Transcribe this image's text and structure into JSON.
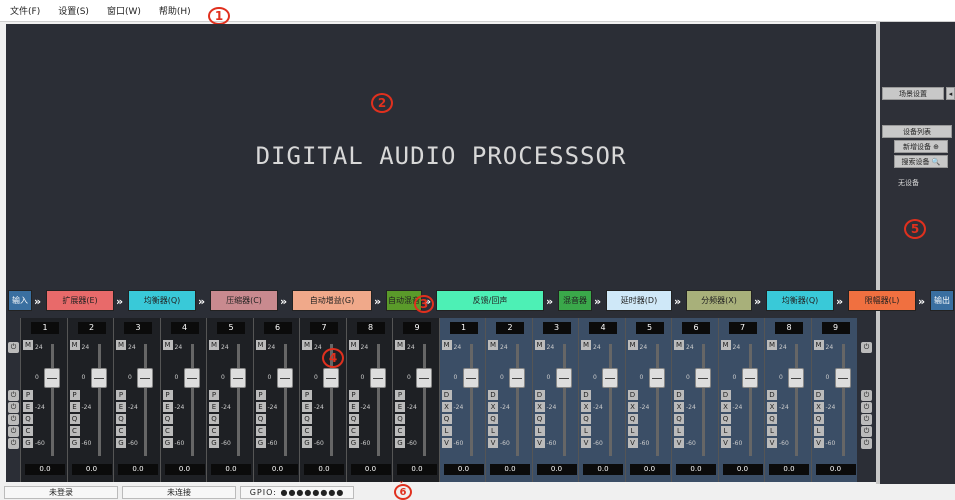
{
  "menu": [
    "文件(F)",
    "设置(S)",
    "窗口(W)",
    "帮助(H)"
  ],
  "main": {
    "title": "DIGITAL AUDIO PROCESSSOR"
  },
  "side": {
    "scene_label": "场景设置",
    "device_list_label": "设备列表",
    "add_device_label": "新增设备 ⊕",
    "search_device_label": "搜索设备 🔍",
    "no_device_text": "无设备"
  },
  "chain": [
    {
      "label": "输入",
      "color": "#3a6fa0"
    },
    {
      "label": "扩展器(E)",
      "color": "#e86a6a"
    },
    {
      "label": "均衡器(Q)",
      "color": "#39c9d8"
    },
    {
      "label": "压缩器(C)",
      "color": "#c98a8f"
    },
    {
      "label": "自动增益(G)",
      "color": "#f0a98a"
    },
    {
      "label": "自动混音",
      "color": "#5a9a2a"
    },
    {
      "label": "反馈/回声",
      "color": "#4df0b5"
    },
    {
      "label": "混音器",
      "color": "#3aa84a"
    },
    {
      "label": "延时器(D)",
      "color": "#cfe8f8"
    },
    {
      "label": "分频器(X)",
      "color": "#a8b07a"
    },
    {
      "label": "均衡器(Q)",
      "color": "#39c9d8"
    },
    {
      "label": "限幅器(L)",
      "color": "#f07040"
    },
    {
      "label": "输出",
      "color": "#3a6fa0"
    }
  ],
  "arrow_glyph": "»",
  "input_channels": [
    {
      "num": "1",
      "value": "0.0",
      "level": 0.7
    },
    {
      "num": "2",
      "value": "0.0",
      "level": 0.7
    },
    {
      "num": "3",
      "value": "0.0",
      "level": 0.7
    },
    {
      "num": "4",
      "value": "0.0",
      "level": 0.7
    },
    {
      "num": "5",
      "value": "0.0",
      "level": 0.7
    },
    {
      "num": "6",
      "value": "0.0",
      "level": 0.7
    },
    {
      "num": "7",
      "value": "0.0",
      "level": 0.7
    },
    {
      "num": "8",
      "value": "0.0",
      "level": 0.7
    },
    {
      "num": "9",
      "value": "0.0",
      "level": 0.7
    }
  ],
  "output_channels": [
    {
      "num": "1",
      "value": "0.0",
      "level": 0.7
    },
    {
      "num": "2",
      "value": "0.0",
      "level": 0.7
    },
    {
      "num": "3",
      "value": "0.0",
      "level": 0.7
    },
    {
      "num": "4",
      "value": "0.0",
      "level": 0.7
    },
    {
      "num": "5",
      "value": "0.0",
      "level": 0.7
    },
    {
      "num": "6",
      "value": "0.0",
      "level": 0.7
    },
    {
      "num": "7",
      "value": "0.0",
      "level": 0.7
    },
    {
      "num": "8",
      "value": "0.0",
      "level": 0.7
    },
    {
      "num": "9",
      "value": "0.0",
      "level": 0.7
    }
  ],
  "strip_buttons_in": [
    "P",
    "E",
    "Q",
    "C",
    "G"
  ],
  "strip_buttons_out": [
    "D",
    "X",
    "Q",
    "L",
    "V"
  ],
  "mute_label": "M",
  "scale_labels": [
    "24",
    "0",
    "-24",
    "-60"
  ],
  "status": {
    "login": "未登录",
    "connection": "未连接",
    "gpio": "GPIO: ●●●●●●●●"
  },
  "callouts": [
    "1",
    "2",
    "3",
    "4",
    "5",
    "6"
  ]
}
